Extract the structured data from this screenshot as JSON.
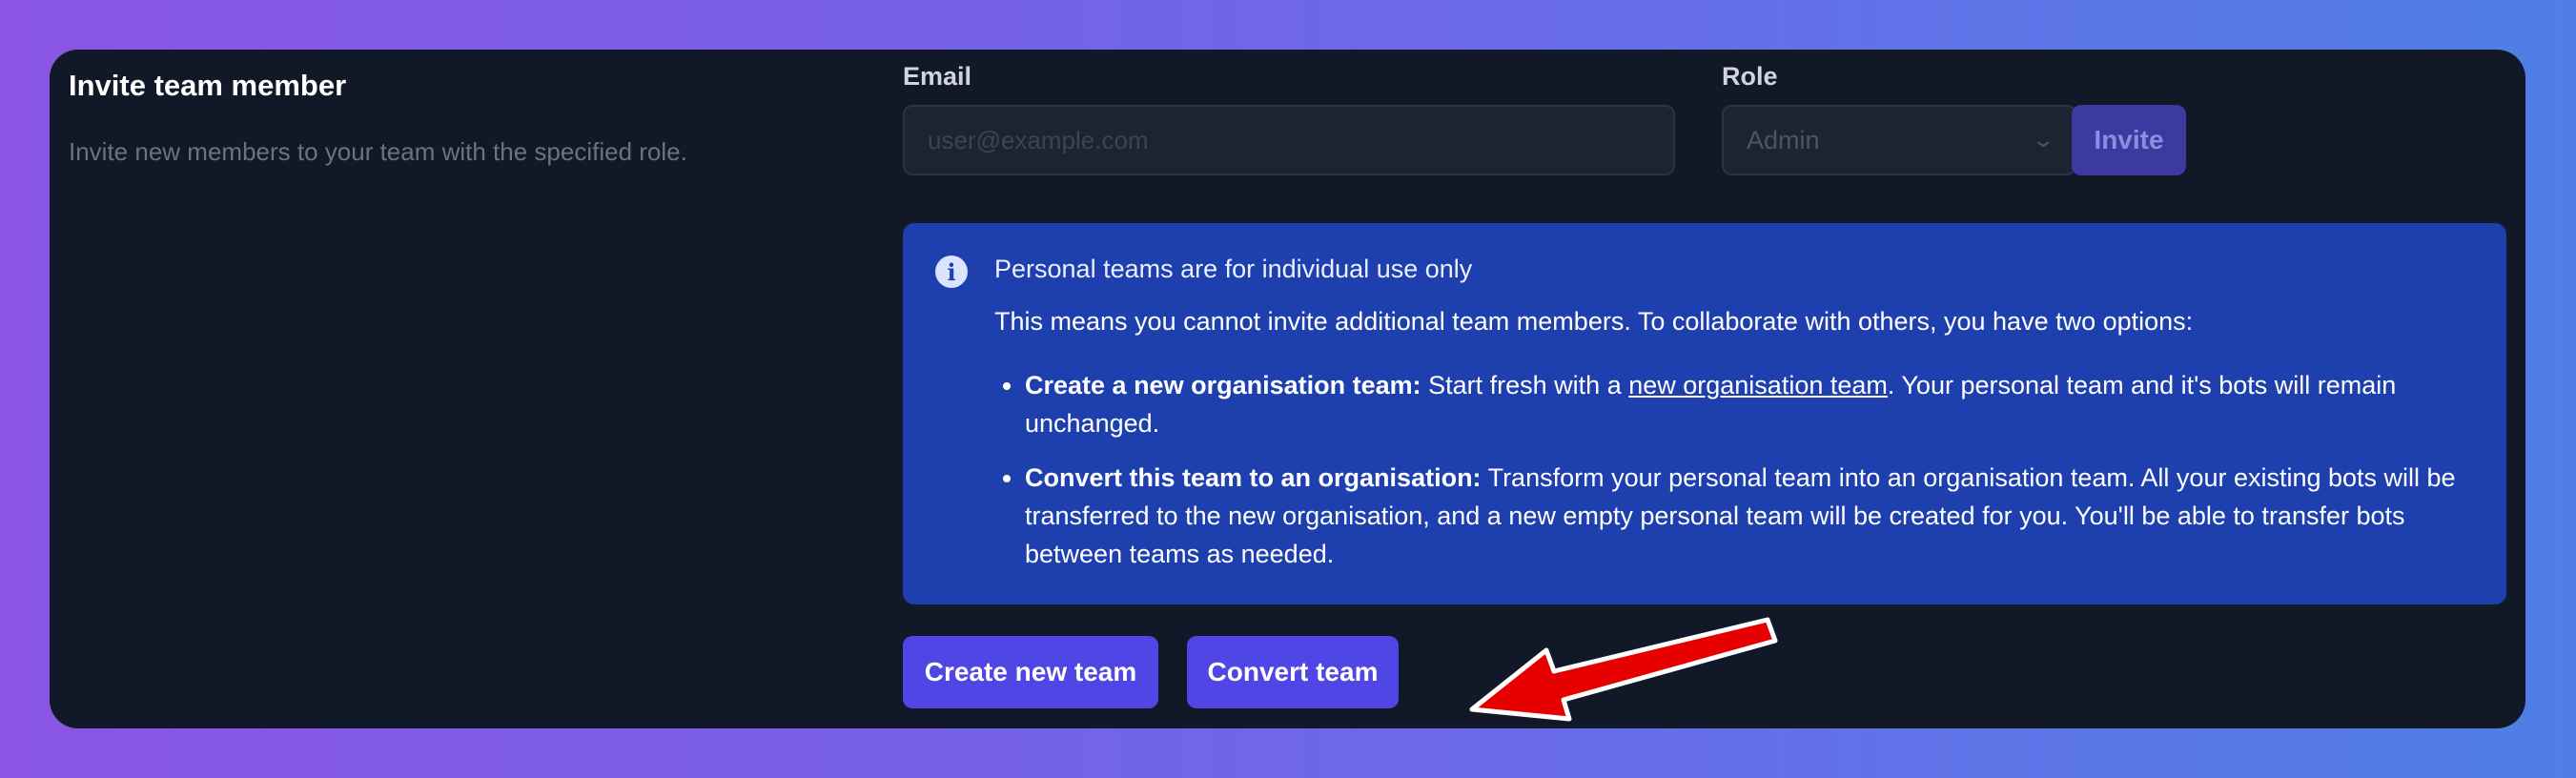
{
  "section": {
    "title": "Invite team member",
    "description": "Invite new members to your team with the specified role."
  },
  "form": {
    "email_label": "Email",
    "email_placeholder": "user@example.com",
    "email_value": "",
    "role_label": "Role",
    "role_value": "Admin",
    "invite_label": "Invite"
  },
  "notice": {
    "icon": "info-icon",
    "heading": "Personal teams are for individual use only",
    "body": "This means you cannot invite additional team members. To collaborate with others, you have two options:",
    "options": [
      {
        "title": "Create a new organisation team:",
        "text_before_link": " Start fresh with a ",
        "link_text": "new organisation team",
        "text_after_link": ". Your personal team and it's bots will remain unchanged."
      },
      {
        "title": "Convert this team to an organisation:",
        "text": " Transform your personal team into an organisation team. All your existing bots will be transferred to the new organisation, and a new empty personal team will be created for you. You'll be able to transfer bots between teams as needed."
      }
    ]
  },
  "actions": {
    "create_label": "Create new team",
    "convert_label": "Convert team"
  },
  "colors": {
    "background_gradient": [
      "#8a55e6",
      "#4f7fe6"
    ],
    "card": "#111827",
    "info_panel": "#1e40af",
    "primary_button": "#4f46e5",
    "annotation_arrow": "#e60000"
  }
}
